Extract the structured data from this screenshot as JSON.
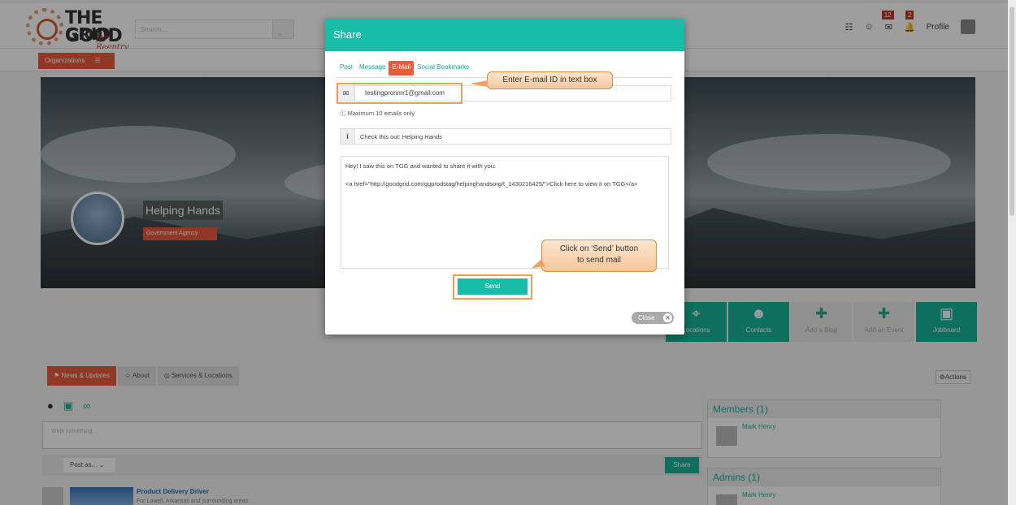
{
  "colors": {
    "teal": "#17bda6",
    "orange": "#e85b3d",
    "highlight": "#f0a050",
    "stripe": [
      "#3a5f8f",
      "#1f6fbf",
      "#2fa58e",
      "#17bda6",
      "#3a9f55",
      "#2fa58e",
      "#1f6fbf"
    ]
  },
  "header": {
    "logo_top": "THE GOOD",
    "logo_bottom": "GRID",
    "logo_tag": "for Reentry",
    "search_placeholder": "Search...",
    "search_icon": "search-icon",
    "messages_count": "12",
    "notifications_count": "2",
    "profile_label": "Profile"
  },
  "subbar": {
    "organizations_label": "Organizations"
  },
  "org": {
    "name": "Helping Hands",
    "type": "Government Agency"
  },
  "tiles": [
    {
      "label": "Locations",
      "icon": "map-marker-icon"
    },
    {
      "label": "Contacts",
      "icon": "contacts-icon"
    },
    {
      "label": "Add a Blog",
      "icon": "plus-icon"
    },
    {
      "label": "Add an Event",
      "icon": "plus-icon"
    },
    {
      "label": "Jobboard",
      "icon": "briefcase-icon"
    }
  ],
  "content": {
    "tabs": [
      "News & Updates",
      "About",
      "Services & Locations"
    ],
    "actions_label": "Actions",
    "write_placeholder": "Write something...",
    "post_as": "Post as...",
    "share_label": "Share",
    "feed": {
      "title": "Product Delivery Driver",
      "subtitle": "For Lowell, Arkansas and surrounding areas"
    }
  },
  "side": {
    "members_title": "Members (1)",
    "member_name": "Mark Henry",
    "admins_title": "Admins (1)",
    "admin_name": "Mark Henry"
  },
  "modal": {
    "title": "Share",
    "tabs": [
      "Post",
      "Message",
      "E-Mail",
      "Social Bookmarks"
    ],
    "active_tab": "E-Mail",
    "email_value": "testingpronmr1@gmail.com",
    "email_note": "Maximum 10 emails only",
    "subject_value": "Check this out: Helping Hands",
    "message_line1": "Hey! I saw this on TGG and wanted to share it with you:",
    "message_line2": "<a href=\"http://goodgrid.com/ggprodstag/helpinghandsorg/t_1430216425/\">Click here to view it on TGG</a>",
    "send_label": "Send",
    "close_label": "Close"
  },
  "callouts": {
    "email": "Enter E-mail ID in text box",
    "send_line1": "Click on ‘Send’ button",
    "send_line2": "to send mail"
  }
}
